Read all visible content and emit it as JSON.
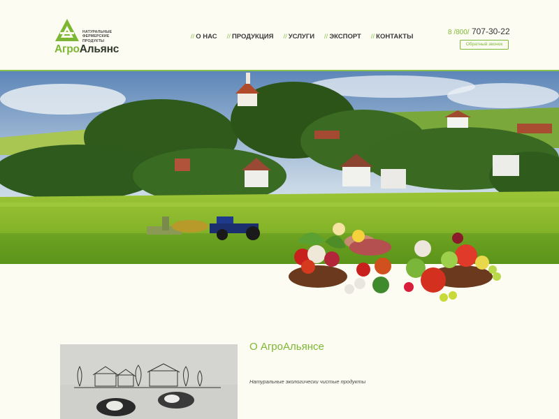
{
  "logo": {
    "tagline": [
      "НАТУРАЛЬНЫЕ",
      "ФЕРМЕРСКИЕ",
      "ПРОДУКТЫ"
    ],
    "name_part1": "Агро",
    "name_part2": "Альянс"
  },
  "nav": {
    "separator": "//",
    "items": [
      "О НАС",
      "ПРОДУКЦИЯ",
      "УСЛУГИ",
      "ЭКСПОРТ",
      "КОНТАКТЫ"
    ]
  },
  "contact": {
    "phone_prefix": "8 /800/",
    "phone_number": "707-30-22",
    "callback_label": "Обратный звонок"
  },
  "about": {
    "title": "О АгроАльянсе",
    "subtitle": "Натуральные экологически чистые продукты"
  },
  "colors": {
    "accent": "#7cb733",
    "background": "#fdfcf3",
    "text_dark": "#2f3a2a"
  }
}
